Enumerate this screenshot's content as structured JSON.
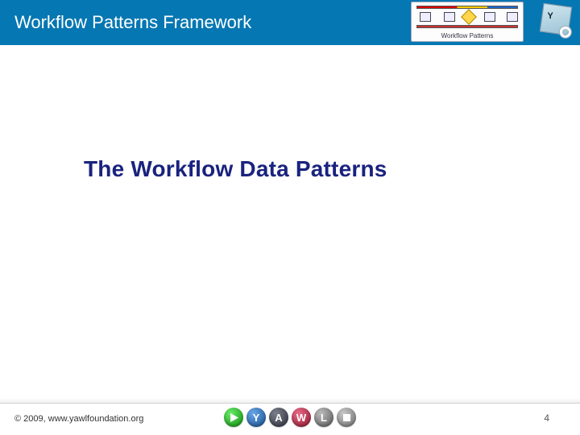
{
  "header": {
    "title": "Workflow Patterns Framework",
    "thumb_label": "Workflow Patterns",
    "corner_letter": "Y"
  },
  "main": {
    "title": "The Workflow Data Patterns"
  },
  "footer": {
    "copyright": "© 2009, www.yawlfoundation.org",
    "page": "4",
    "badges": {
      "y": "Y",
      "a": "A",
      "w": "W",
      "l": "L"
    }
  }
}
